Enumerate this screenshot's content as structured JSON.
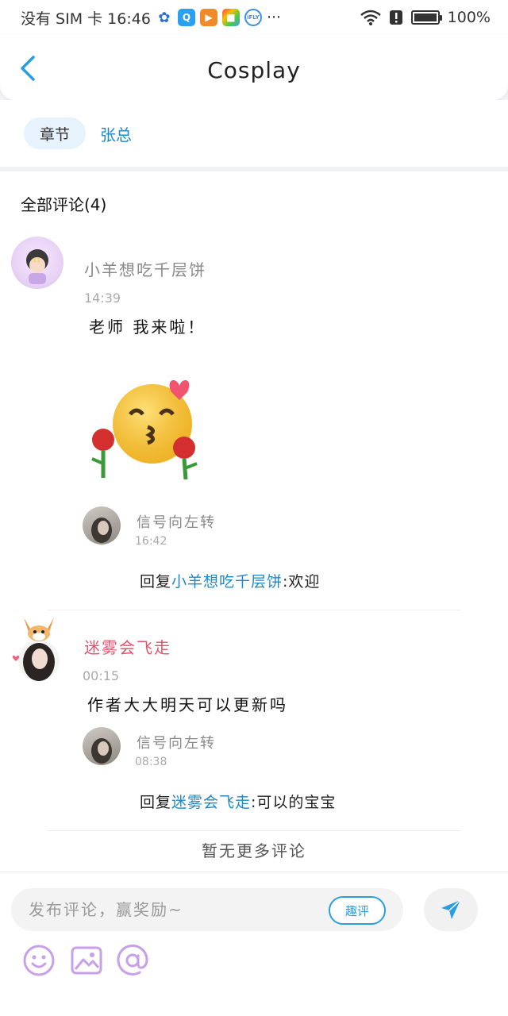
{
  "status_bar": {
    "left_text": "没有 SIM 卡 16:46",
    "more": "···",
    "battery_text": "100%",
    "battery_level": 1.0
  },
  "header": {
    "title": "Cosplay",
    "back_icon": "chevron-left-icon"
  },
  "chips": {
    "chapter": "章节",
    "author": "张总"
  },
  "comments_section": {
    "title": "全部评论(4)",
    "items": [
      {
        "username": "小羊想吃千层饼",
        "time": "14:39",
        "text": "老师 我来啦！",
        "reply": {
          "username": "信号向左转",
          "time": "16:42",
          "prefix": "回复",
          "mention": "小羊想吃千层饼",
          "text": ":欢迎"
        }
      },
      {
        "username": "迷雾会飞走",
        "time": "00:15",
        "text": "作者大大明天可以更新吗",
        "reply": {
          "username": "信号向左转",
          "time": "08:38",
          "prefix": "回复",
          "mention": "迷雾会飞走",
          "text": ":可以的宝宝"
        }
      }
    ],
    "end_note": "暂无更多评论"
  },
  "composer": {
    "placeholder": "发布评论，赢奖励~",
    "qu_label": "趣评",
    "icons": [
      "emoji-icon",
      "image-icon",
      "at-icon",
      "send-icon"
    ]
  },
  "colors": {
    "accent": "#1e88c7",
    "pink_username": "#e0536d",
    "chip_bg": "#e6f3fc"
  }
}
